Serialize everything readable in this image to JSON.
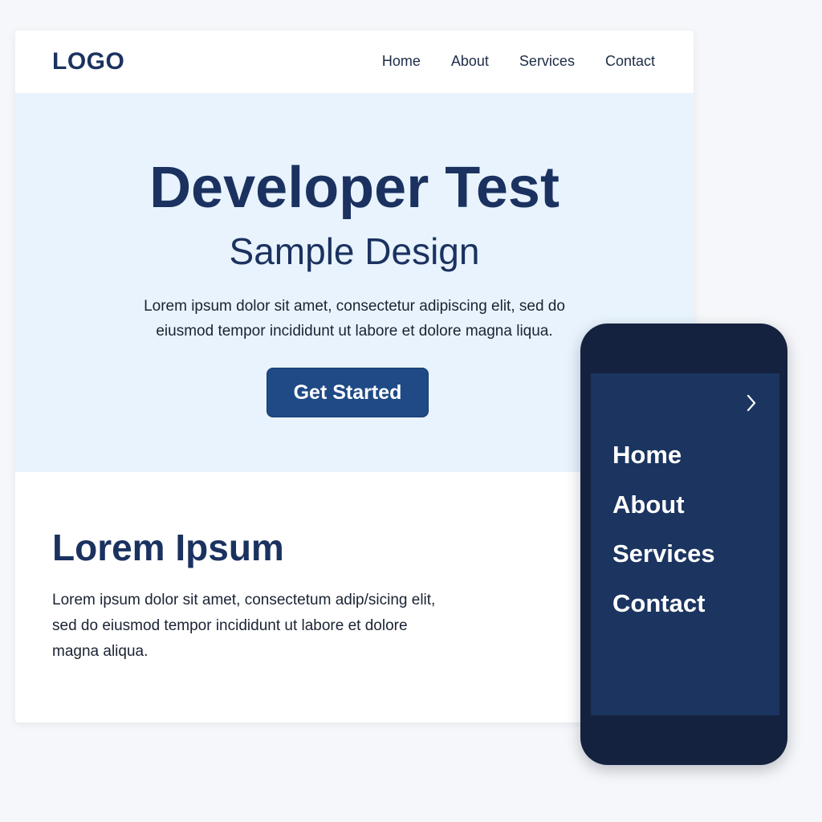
{
  "header": {
    "logo": "LOGO",
    "nav": [
      "Home",
      "About",
      "Services",
      "Contact"
    ]
  },
  "hero": {
    "title": "Developer Test",
    "subtitle": "Sample Design",
    "body_line1": "Lorem ipsum dolor sit amet, consectetur adipiscing elit, sed do",
    "body_line2": "eiusmod tempor incididunt ut labore et dolore magna liqua.",
    "cta_label": "Get Started"
  },
  "section": {
    "title": "Lorem Ipsum",
    "body_line1": "Lorem ipsum dolor sit amet, consectetum adip/sicing elit,",
    "body_line2": "sed do eiusmod tempor incididunt ut labore et dolore",
    "body_line3": "magna aliqua."
  },
  "mobile_menu": {
    "items": [
      "Home",
      "About",
      "Services",
      "Contact"
    ],
    "chevron_icon": "chevron-right-icon"
  },
  "colors": {
    "brand": "#1b3260",
    "hero_bg": "#e8f3fd",
    "button": "#1f4a86",
    "phone_frame": "#15223f",
    "phone_screen": "#1b3460"
  }
}
